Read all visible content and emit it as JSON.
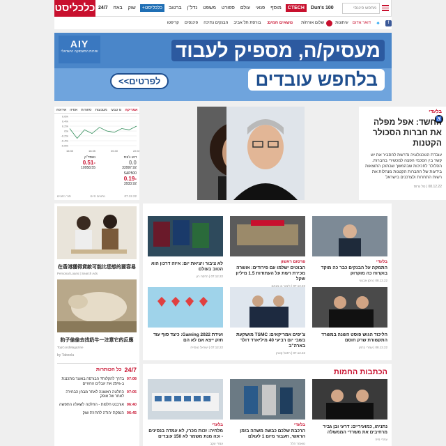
{
  "header": {
    "logo": "כלכליסט",
    "nav": [
      "24/7",
      "באזז",
      "שוק",
      "ברטוב",
      "נדל\"ן",
      "משפט",
      "ספורט",
      "עולם",
      "פנאי",
      "מוסף",
      "CTECH",
      "Dun's 100"
    ],
    "search_placeholder": "מחפש פיננסי",
    "sub_label": "כלכליסט+"
  },
  "subbar": {
    "topics_label": "נושאים חמים:",
    "topics": [
      "בורסת תל אביב",
      "הבנקים נתיכה",
      "פיננסים",
      "קריפטו"
    ],
    "login": "שלום אורח/ת",
    "mail": "דואר אדום",
    "weather": "עיתונות"
  },
  "banner": {
    "line1": "מעסיק/ה, מספיק לעבוד",
    "line2": "בלחפש עובדים",
    "cta": "לפרטים>>",
    "brand_big": "AIY",
    "brand_small": "שירות התעסוקה הישראלי"
  },
  "hero": {
    "kicker": "בלעדי",
    "title": "החשד: אפל מפלה את חברות הסכולר הקטנות",
    "body": "עובדת הטכנולוגיה נדרשת להסביר את יש קשר בין הסכמי הפצה למכשירי בחברות. הסלולר לחכיכות שבהמשך שבתוכן התוצאות בידעות של החברות הקטנות מנהלות את רשות התחרות ולצרכנים בישראל",
    "meta": "08.12.22 | טל גרוס"
  },
  "ticker": {
    "tabs": [
      "ת\"א 35",
      "ת\"א 125",
      "אירופה",
      "אסיה",
      "סחורות",
      "מטבעות",
      "גז טבעי",
      "אמריקה"
    ],
    "quotes": [
      {
        "label": "דאו ג'ונס",
        "value": "33997.92",
        "change": "0.0"
      },
      {
        "label": "נאסד\"ק",
        "value": "10958.55",
        "change": "-0.51"
      },
      {
        "label": "S&P500",
        "value": "3933.92",
        "change": "-0.19"
      }
    ],
    "foot_left": "תור נתונים",
    "foot_right": "נתונים חיים",
    "date": "07.12.22",
    "x_ticks": [
      "16:30",
      "18:35",
      "20:40",
      "22:45"
    ],
    "y_ticks": [
      "0.6%",
      "0.4%",
      "0.2%",
      "0%",
      "-0.2%",
      "-0.4%",
      "-0.6%"
    ]
  },
  "chart_data": {
    "type": "line",
    "x": [
      "16:30",
      "18:35",
      "20:40",
      "22:45"
    ],
    "series": [
      {
        "values": [
          0.1,
          -0.3,
          0.05,
          -0.1,
          0.15,
          0.0,
          -0.05,
          0.1,
          0.05,
          0.2
        ]
      }
    ],
    "ylim": [
      -0.6,
      0.6
    ]
  },
  "sponsored": {
    "ads": [
      {
        "caption": "在香港獲得貸款可能比您想的要容易",
        "source": "Personal Loans | Search Ads"
      },
      {
        "caption": "豹子偷偷去找奶牛一注意它的反應",
        "source": "TopCondMagazine"
      }
    ],
    "taboola": "by Taboola"
  },
  "news247": {
    "title": "כל הכותרות",
    "badge": "24/7",
    "items": [
      {
        "time": "07:08",
        "text": "בדרך להקלות? הבורסה באוצר מתכננת ב-25% את יגבלים החוזיים"
      },
      {
        "time": "07:05",
        "text": "החלטה ראשונה לאחר מבחן הבחירה לאחר של אופק"
      },
      {
        "time": "06:40",
        "text": "אורבנט חלפות - החלטה לשאלה התפשה"
      },
      {
        "time": "06:45",
        "text": "הנפקת יהודה לחרורת שוק"
      }
    ]
  },
  "grid": {
    "cards": [
      {
        "kicker": "בלעדי",
        "title": "התמקה על הבנקים כבר כה מוקד בוקרוח כה מוקרוק",
        "meta": "08.12.22 | ניסן אבנוני"
      },
      {
        "kicker": "פרסום ראשון",
        "title": "הבוטים ישלמו עם פירודים: אושרה מכירת רשת על העתודות 1.5 מיליון שקל",
        "meta": "07.12.22 | לימור בן מנחם"
      },
      {
        "kicker": "",
        "title": "לא ציבור ויציאת יום: איזה דרכון הוא הטוב בעולם",
        "meta": "07.12.22 | הדסה רון"
      },
      {
        "kicker": "",
        "title": "הליכוד הגוש פוסט השנה במשרד התקשורת שרק חוסם",
        "meta": "08.12.22 | עמרי ברמן"
      },
      {
        "kicker": "",
        "title": "צ'יפים אמריקאים: TSMC מושקעת בשבי יום רביעי 40 מיליארד דולר בארה\"ב",
        "meta": "07.12.22 | רפאל קאהן"
      },
      {
        "kicker": "",
        "title": "ועידת Gaming 2022: כיצד סוף עוד חזק ייצא אם לא הם",
        "meta": "07.12.22 | ישראל טוסייה"
      }
    ]
  },
  "hot": {
    "title": "הכתבות החמות",
    "cards": [
      {
        "kicker": "",
        "title": "נתניהו, כמועיריים: דרעי ובן גביר מרחיבים את משרדי הממשלה",
        "meta": "עמרי מיה"
      },
      {
        "kicker": "בלעדי",
        "title": "הרכבת שלכם כבשה משהה בזמן הראשי, תעבור מיום 1 לעולם",
        "meta": "טואמר הלל"
      },
      {
        "kicker": "בלעדי",
        "title": "מלחיה: זכות מכרז, לא עמדה בנסינים - וכה מנת משמר לא 150 עובדים",
        "meta": "עמרי עקב"
      }
    ]
  }
}
